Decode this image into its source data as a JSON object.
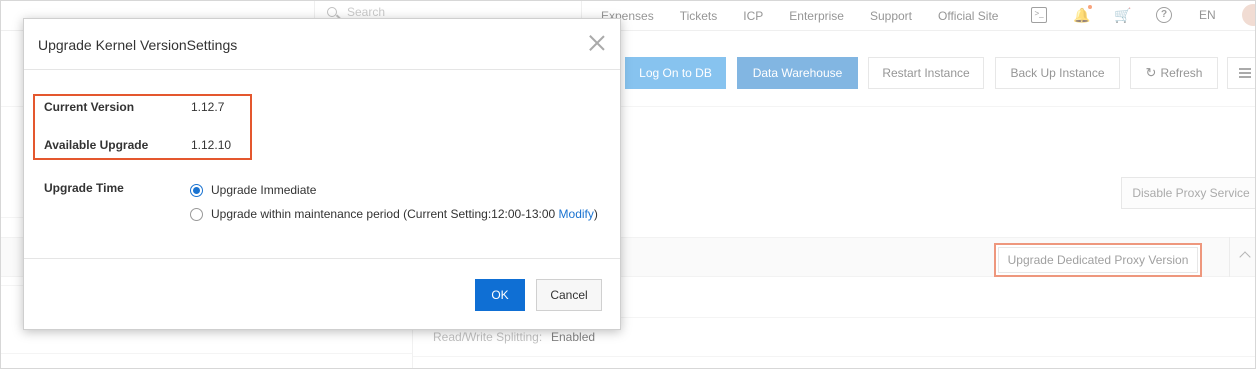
{
  "topnav": {
    "search_placeholder": "Search",
    "links": [
      "Expenses",
      "Tickets",
      "ICP",
      "Enterprise",
      "Support",
      "Official Site"
    ],
    "icons": [
      "terminal-icon",
      "bell-icon",
      "cart-icon",
      "help-icon"
    ],
    "language": "EN"
  },
  "actions": {
    "log_on_db": "Log On to DB",
    "data_warehouse": "Data Warehouse",
    "restart_instance": "Restart Instance",
    "back_up_instance": "Back Up Instance",
    "refresh": "Refresh"
  },
  "proxy": {
    "disable_proxy": "Disable Proxy Service",
    "upgrade_proxy_version": "Upgrade Dedicated Proxy Version",
    "rw_splitting_label": "Read/Write Splitting:",
    "rw_splitting_value": "Enabled"
  },
  "dialog": {
    "title": "Upgrade Kernel VersionSettings",
    "current_version_label": "Current Version",
    "current_version_value": "1.12.7",
    "available_upgrade_label": "Available Upgrade",
    "available_upgrade_value": "1.12.10",
    "upgrade_time_label": "Upgrade Time",
    "options": {
      "immediate": "Upgrade Immediate",
      "maintenance_prefix": "Upgrade within maintenance period (Current Setting:12:00-13:00 ",
      "modify": "Modify",
      "maintenance_suffix": ")"
    },
    "selected_option": "immediate",
    "ok": "OK",
    "cancel": "Cancel"
  },
  "colors": {
    "primary": "#0f6fd4",
    "highlight": "#e4572e",
    "link": "#1a73d1"
  }
}
